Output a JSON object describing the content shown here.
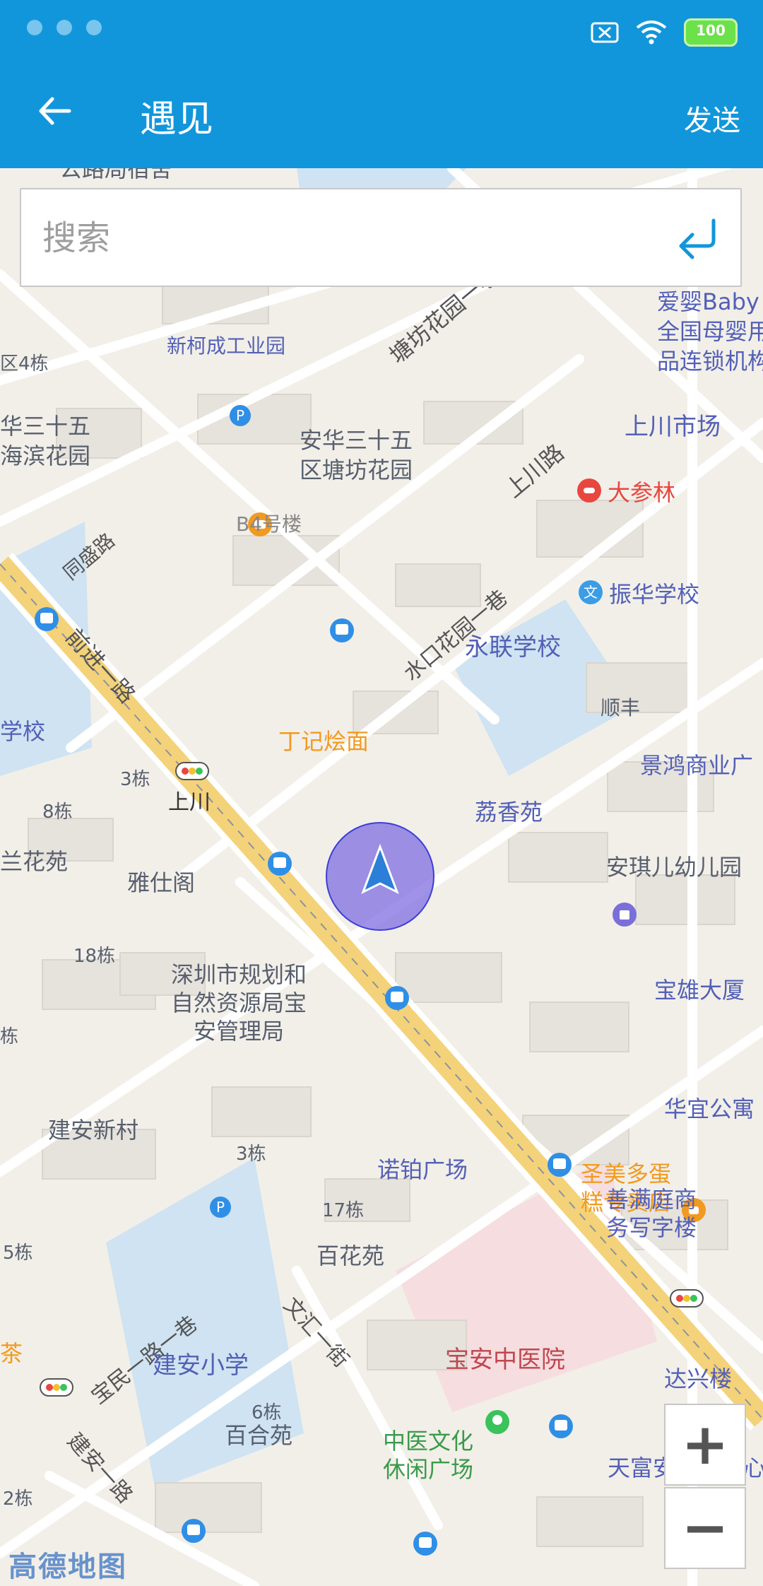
{
  "app": {
    "title": "遇见",
    "send_label": "发送",
    "battery": "100"
  },
  "search": {
    "placeholder": "搜索"
  },
  "map": {
    "logo": "高德地图",
    "labels": [
      {
        "text": "公路局宿舍"
      },
      {
        "text": "新柯成工业园"
      },
      {
        "text": "塘坊花园一巷"
      },
      {
        "text": "爱婴Baby"
      },
      {
        "text": "全国母婴用"
      },
      {
        "text": "品连锁机构"
      },
      {
        "text": "区4栋"
      },
      {
        "text": "华三十五"
      },
      {
        "text": "海滨花园"
      },
      {
        "text": "安华三十五"
      },
      {
        "text": "区塘坊花园"
      },
      {
        "text": "上川市场"
      },
      {
        "text": "上川路"
      },
      {
        "text": "大参林"
      },
      {
        "text": "B4号楼"
      },
      {
        "text": "同盛路"
      },
      {
        "text": "振华学校"
      },
      {
        "text": "水口花园一巷"
      },
      {
        "text": "前进一路"
      },
      {
        "text": "永联学校"
      },
      {
        "text": "顺丰"
      },
      {
        "text": "学校"
      },
      {
        "text": "丁记烩面"
      },
      {
        "text": "景鸿商业广"
      },
      {
        "text": "3栋"
      },
      {
        "text": "上川"
      },
      {
        "text": "荔香苑"
      },
      {
        "text": "8栋"
      },
      {
        "text": "兰花苑"
      },
      {
        "text": "雅仕阁"
      },
      {
        "text": "安琪儿幼儿园"
      },
      {
        "text": "18栋"
      },
      {
        "text": "深圳市规划和"
      },
      {
        "text": "自然资源局宝"
      },
      {
        "text": "安管理局"
      },
      {
        "text": "宝雄大厦"
      },
      {
        "text": "圣美多蛋"
      },
      {
        "text": "糕专卖店"
      },
      {
        "text": "栋"
      },
      {
        "text": "华宜公寓"
      },
      {
        "text": "建安新村"
      },
      {
        "text": "3栋"
      },
      {
        "text": "诺铂广场"
      },
      {
        "text": "善满庭商"
      },
      {
        "text": "务写字楼"
      },
      {
        "text": "17栋"
      },
      {
        "text": "5栋"
      },
      {
        "text": "百花苑"
      },
      {
        "text": "宝民一路一巷"
      },
      {
        "text": "文汇一街"
      },
      {
        "text": "建安小学"
      },
      {
        "text": "宝安中医院"
      },
      {
        "text": "达兴楼"
      },
      {
        "text": "茶"
      },
      {
        "text": "6栋"
      },
      {
        "text": "百合苑"
      },
      {
        "text": "中医文化"
      },
      {
        "text": "休闲广场"
      },
      {
        "text": "天富安商务中心"
      },
      {
        "text": "建安一路"
      },
      {
        "text": "2栋"
      }
    ]
  },
  "colors": {
    "appbar": "#1296db",
    "road_major": "#f4d27a",
    "road_minor": "#ffffff",
    "water": "#cfe3f2",
    "location": "#7f6ee0",
    "poi_blue": "#5360b6",
    "poi_orange": "#f29a1f",
    "poi_red": "#e8473f"
  },
  "icons": [
    "back-arrow-icon",
    "enter-return-icon",
    "location-arrow-icon",
    "zoom-in-icon",
    "zoom-out-icon",
    "bus-stop-icon",
    "traffic-light-icon",
    "parking-icon"
  ]
}
